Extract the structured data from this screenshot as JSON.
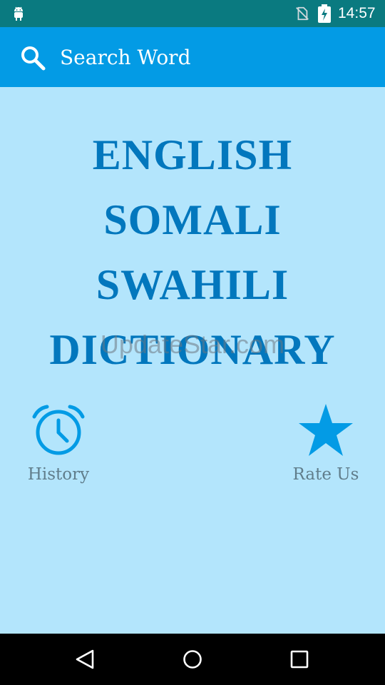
{
  "status_bar": {
    "time": "14:57",
    "icons": [
      "android-icon",
      "no-sim-icon",
      "battery-charging-icon"
    ]
  },
  "app_bar": {
    "search_label": "Search Word",
    "icon": "search-icon"
  },
  "title": {
    "lines": [
      "ENGLISH",
      "SOMALI",
      "SWAHILI",
      "DICTIONARY"
    ]
  },
  "watermark": "UpdateStar.com",
  "actions": {
    "history": {
      "label": "History",
      "icon": "alarm-clock-icon"
    },
    "rate": {
      "label": "Rate Us",
      "icon": "star-icon"
    }
  },
  "nav_bar": {
    "icons": [
      "back-icon",
      "home-icon",
      "recents-icon"
    ]
  },
  "colors": {
    "status_bar": "#0a7a80",
    "app_bar": "#039be5",
    "background": "#b3e5fc",
    "title_text": "#0277bd",
    "accent_icon": "#039be5",
    "label_text": "#607d8b"
  }
}
